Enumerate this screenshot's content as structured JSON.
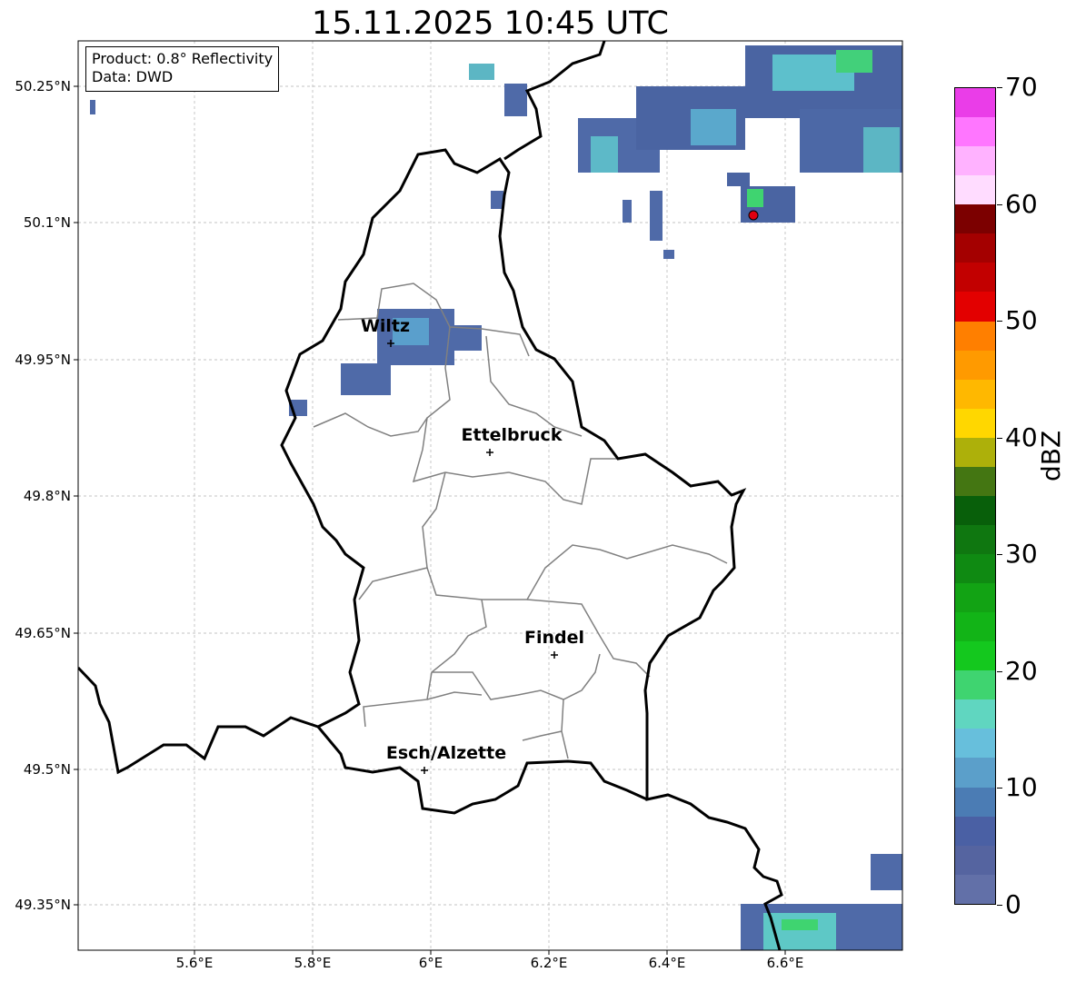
{
  "title": "15.11.2025 10:45 UTC",
  "info": {
    "product": "Product: 0.8° Reflectivity",
    "source": "Data: DWD"
  },
  "map": {
    "lon_range": [
      5.4,
      6.8
    ],
    "lat_range": [
      49.3,
      50.3
    ],
    "lat_ticks": [
      "50.25°N",
      "50.1°N",
      "49.95°N",
      "49.8°N",
      "49.65°N",
      "49.5°N",
      "49.35°N"
    ],
    "lon_ticks": [
      "5.6°E",
      "5.8°E",
      "6°E",
      "6.2°E",
      "6.4°E",
      "6.6°E"
    ],
    "gridlines": true,
    "cities": [
      {
        "name": "Wiltz",
        "lon": 5.93,
        "lat": 49.97
      },
      {
        "name": "Ettelbruck",
        "lon": 6.1,
        "lat": 49.85
      },
      {
        "name": "Findel",
        "lon": 6.21,
        "lat": 49.63
      },
      {
        "name": "Esch/Alzette",
        "lon": 5.99,
        "lat": 49.5
      }
    ],
    "radar_site": {
      "lon": 6.55,
      "lat": 50.11,
      "color": "#e0000f"
    }
  },
  "colorbar": {
    "label": "dBZ",
    "min": 0,
    "max": 70,
    "ticks": [
      "70",
      "60",
      "50",
      "40",
      "30",
      "20",
      "10",
      "0"
    ],
    "colors": [
      "#6270a8",
      "#5564a0",
      "#4a60a4",
      "#4b7cb4",
      "#5b9fca",
      "#67bfdc",
      "#60d6c0",
      "#3fd470",
      "#14c81e",
      "#12b417",
      "#12a314",
      "#0f8a12",
      "#0f7710",
      "#085f0a",
      "#447612",
      "#adb00a",
      "#ffd700",
      "#ffb800",
      "#ff9a00",
      "#ff7f00",
      "#e30000",
      "#c20000",
      "#a40000",
      "#7c0000",
      "#ffdcff",
      "#ffb2ff",
      "#ff76ff",
      "#ea3de8"
    ]
  }
}
